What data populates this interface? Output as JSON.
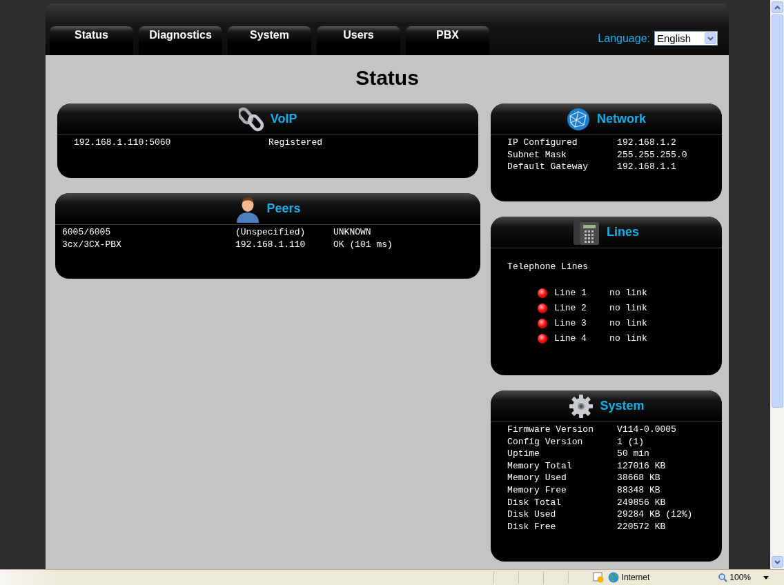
{
  "tabs": [
    {
      "label": "Status"
    },
    {
      "label": "Diagnostics"
    },
    {
      "label": "System"
    },
    {
      "label": "Users"
    },
    {
      "label": "PBX"
    }
  ],
  "language": {
    "label": "Language:",
    "value": "English"
  },
  "page_title": "Status",
  "voip": {
    "title": "VoIP",
    "rows": [
      [
        "192.168.1.110:5060",
        "Registered"
      ]
    ]
  },
  "peers": {
    "title": "Peers",
    "rows": [
      [
        "6005/6005",
        "(Unspecified)",
        "UNKNOWN"
      ],
      [
        "3cx/3CX-PBX",
        "192.168.1.110",
        "OK (101 ms)"
      ]
    ]
  },
  "network": {
    "title": "Network",
    "rows": [
      [
        "IP Configured",
        "192.168.1.2"
      ],
      [
        "Subnet Mask",
        "255.255.255.0"
      ],
      [
        "Default Gateway",
        "192.168.1.1"
      ]
    ]
  },
  "lines": {
    "title": "Lines",
    "subtitle": "Telephone Lines",
    "items": [
      {
        "name": "Line 1",
        "status": "no link",
        "linked": false
      },
      {
        "name": "Line 2",
        "status": "no link",
        "linked": false
      },
      {
        "name": "Line 3",
        "status": "no link",
        "linked": false
      },
      {
        "name": "Line 4",
        "status": "no link",
        "linked": false
      }
    ]
  },
  "system": {
    "title": "System",
    "rows": [
      [
        "Firmware Version",
        "V114-0.0005"
      ],
      [
        "Config Version",
        "1 (1)"
      ],
      [
        "Uptime",
        "50 min"
      ],
      [
        "Memory Total",
        "127016 KB"
      ],
      [
        "Memory Used",
        "38668 KB"
      ],
      [
        "Memory Free",
        "88348 KB"
      ],
      [
        "Disk Total",
        "249856 KB"
      ],
      [
        "Disk Used",
        "29284 KB (12%)"
      ],
      [
        "Disk Free",
        "220572 KB"
      ]
    ]
  },
  "status_bar": {
    "zone": "Internet",
    "zoom": "100%"
  }
}
